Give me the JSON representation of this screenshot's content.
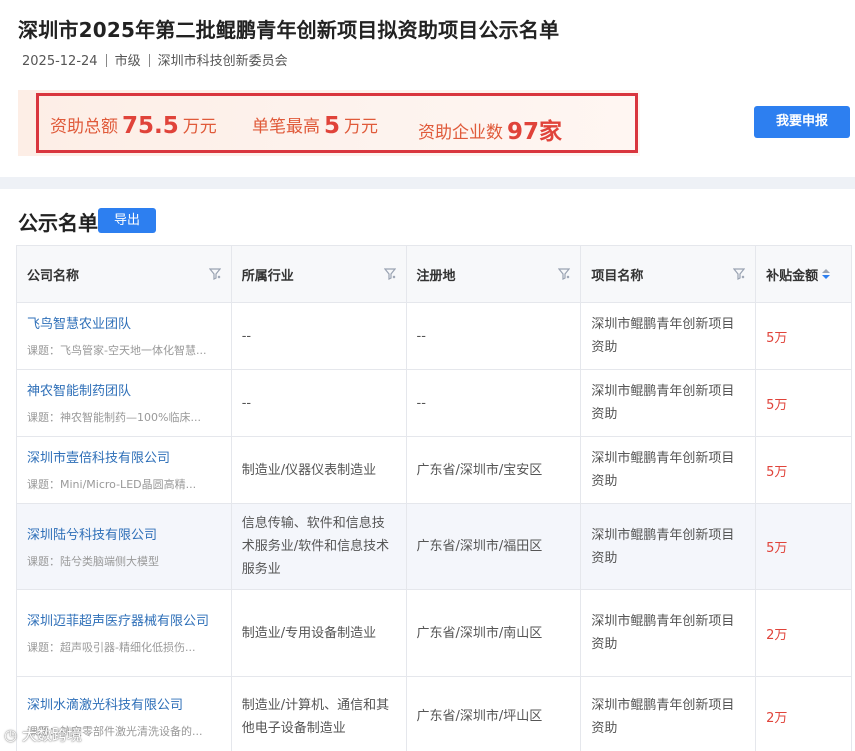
{
  "header": {
    "title": "深圳市2025年第二批鲲鹏青年创新项目拟资助项目公示名单",
    "date": "2025-12-24",
    "level": "市级",
    "department": "深圳市科技创新委员会"
  },
  "summary": {
    "total_label": "资助总额",
    "total_value": "75.5",
    "total_unit": "万元",
    "max_label": "单笔最高",
    "max_value": "5",
    "max_unit": "万元",
    "count_label": "资助企业数",
    "count_value": "97家"
  },
  "apply_button": "我要申报",
  "list": {
    "title": "公示名单",
    "export_button": "导出",
    "columns": [
      "公司名称",
      "所属行业",
      "注册地",
      "项目名称",
      "补贴金额"
    ]
  },
  "rows": [
    {
      "company": "飞鸟智慧农业团队",
      "subject": "课题：飞鸟管家-空天地一体化智慧...",
      "industry": "--",
      "region": "--",
      "project": "深圳市鲲鹏青年创新项目资助",
      "amount": "5万"
    },
    {
      "company": "神农智能制药团队",
      "subject": "课题：神农智能制药—100%临床...",
      "industry": "--",
      "region": "--",
      "project": "深圳市鲲鹏青年创新项目资助",
      "amount": "5万"
    },
    {
      "company": "深圳市壹倍科技有限公司",
      "subject": "课题：Mini/Micro-LED晶圆高精...",
      "industry": "制造业/仪器仪表制造业",
      "region": "广东省/深圳市/宝安区",
      "project": "深圳市鲲鹏青年创新项目资助",
      "amount": "5万"
    },
    {
      "company": "深圳陆兮科技有限公司",
      "subject": "课题：陆兮类脑端侧大模型",
      "industry": "信息传输、软件和信息技术服务业/软件和信息技术服务业",
      "region": "广东省/深圳市/福田区",
      "project": "深圳市鲲鹏青年创新项目资助",
      "amount": "5万"
    },
    {
      "company": "深圳迈菲超声医疗器械有限公司",
      "subject": "课题：超声吸引器-精细化低损伤...",
      "industry": "制造业/专用设备制造业",
      "region": "广东省/深圳市/南山区",
      "project": "深圳市鲲鹏青年创新项目资助",
      "amount": "2万"
    },
    {
      "company": "深圳水滴激光科技有限公司",
      "subject": "课题：航空零部件激光清洗设备的...",
      "industry": "制造业/计算机、通信和其他电子设备制造业",
      "region": "广东省/深圳市/坪山区",
      "project": "深圳市鲲鹏青年创新项目资助",
      "amount": "2万"
    }
  ],
  "watermark": "大数跨境",
  "colors": {
    "accent": "#2d7ff0",
    "highlight": "#e0433a",
    "frame": "#d9363e"
  }
}
